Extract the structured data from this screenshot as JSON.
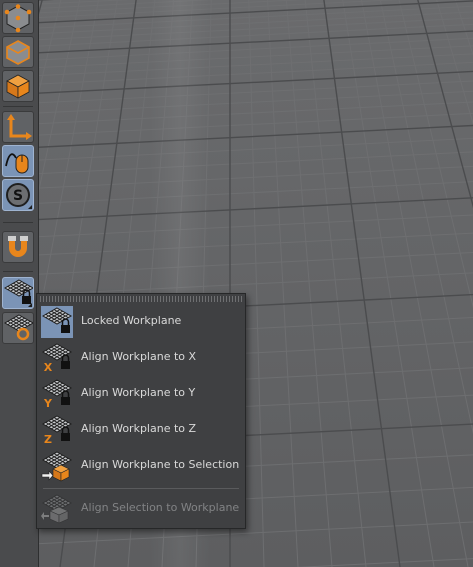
{
  "menu": {
    "items": [
      {
        "label": "Locked Workplane",
        "icon": "locked-workplane-icon"
      },
      {
        "label": "Align Workplane to X",
        "icon": "align-workplane-x-icon",
        "axis": "X"
      },
      {
        "label": "Align Workplane to Y",
        "icon": "align-workplane-y-icon",
        "axis": "Y"
      },
      {
        "label": "Align Workplane to Z",
        "icon": "align-workplane-z-icon",
        "axis": "Z"
      },
      {
        "label": "Align Workplane to Selection",
        "icon": "align-workplane-selection-icon"
      }
    ],
    "disabled_item": {
      "label": "Align Selection to Workplane",
      "icon": "align-selection-workplane-icon"
    }
  },
  "toolbar": {
    "s_glyph": "S"
  },
  "colors": {
    "accent_orange": "#e8861c",
    "active_blue": "#7b94b6",
    "viewport_bg": "#5f6062"
  }
}
